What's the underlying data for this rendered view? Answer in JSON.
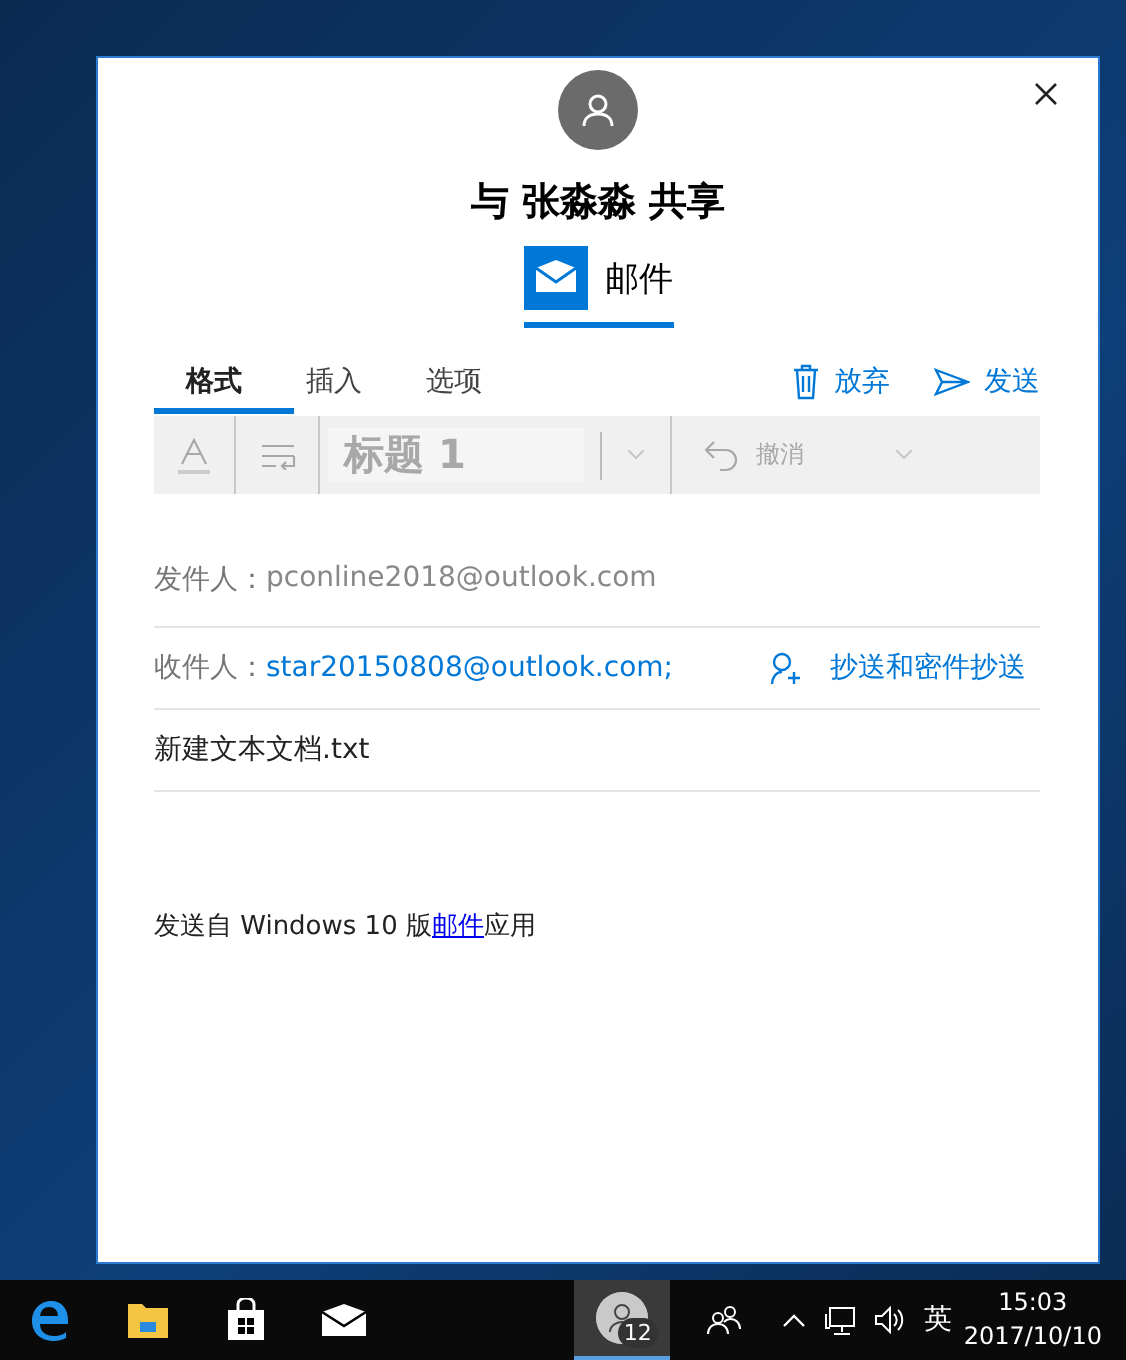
{
  "share": {
    "title": "与 张淼淼 共享",
    "app": {
      "name": "邮件",
      "selected": true
    }
  },
  "tabs": [
    {
      "label": "格式",
      "selected": true
    },
    {
      "label": "插入",
      "selected": false
    },
    {
      "label": "选项",
      "selected": false
    }
  ],
  "actions": [
    {
      "kind": "discard",
      "label": "放弃"
    },
    {
      "kind": "send",
      "label": "发送"
    }
  ],
  "toolbar": {
    "style": "标题 1",
    "undo": "撤消",
    "disabled": true
  },
  "from": {
    "label": "发件人：",
    "value": "pconline2018@outlook.com"
  },
  "to": {
    "label": "收件人：",
    "value": "star20150808@outlook.com;",
    "cc": "抄送和密件抄送"
  },
  "subject": "新建文本文档.txt",
  "signature": {
    "before": "发送自 Windows 10 版",
    "link": "邮件",
    "after": "应用"
  },
  "taskbar": {
    "apps": [
      {
        "kind": "edge"
      },
      {
        "kind": "explorer"
      },
      {
        "kind": "store"
      },
      {
        "kind": "mail"
      }
    ],
    "people_badge": "12",
    "language": "英",
    "time": "15:03",
    "date": "2017/10/10"
  }
}
